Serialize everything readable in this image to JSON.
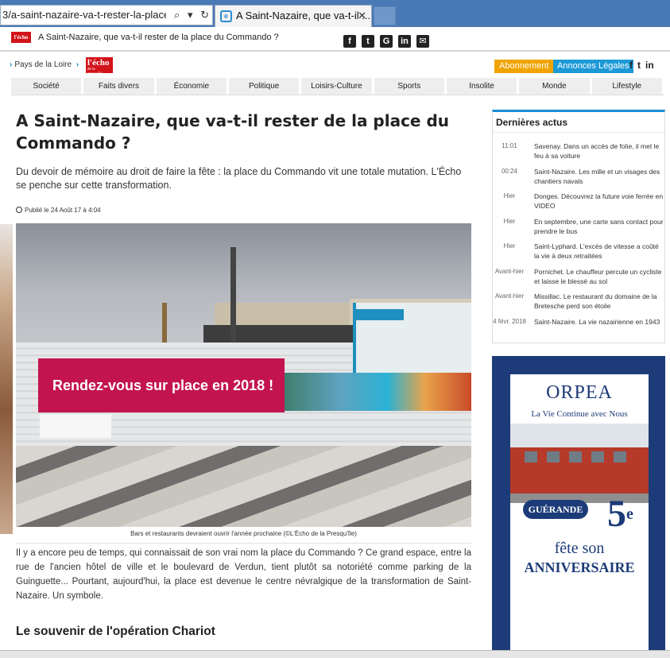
{
  "browser": {
    "url": "3/a-saint-nazaire-va-t-rester-la-place-co",
    "tab_title": "A Saint-Nazaire, que va-t-il ...",
    "tab_close": "✕",
    "search_glyph": "⌕",
    "reload_glyph": "↻",
    "favicon_letter": "e"
  },
  "topbar": {
    "logo": "l'écho",
    "title": "A Saint-Nazaire, que va-t-il rester de la place du Commando ?",
    "share_icons": [
      {
        "name": "facebook-icon",
        "glyph": "f"
      },
      {
        "name": "twitter-icon",
        "glyph": "t"
      },
      {
        "name": "google-plus-icon",
        "glyph": "G"
      },
      {
        "name": "linkedin-icon",
        "glyph": "in"
      },
      {
        "name": "email-icon",
        "glyph": "✉"
      }
    ]
  },
  "header": {
    "breadcrumb": "Pays de la Loire",
    "logo_top": "l'écho",
    "logo_bottom": "de la presqu'île",
    "abonnement": "Abonnement",
    "annonces": "Annonces Légales",
    "social": [
      "f",
      "t",
      "in"
    ]
  },
  "nav": [
    "Société",
    "Faits divers",
    "Économie",
    "Politique",
    "Loisirs-Culture",
    "Sports",
    "Insolite",
    "Monde",
    "Lifestyle"
  ],
  "article": {
    "title": "A Saint-Nazaire, que va-t-il rester de la place du Commando ?",
    "chapo": "Du devoir de mémoire au droit de faire la fête : la place du Commando vit une totale mutation. L'Écho se penche sur cette transformation.",
    "published": "Publié le 24 Août 17 à 4:04",
    "photo_banner_text": "Rendez-vous sur place en 2018 !",
    "caption": "Bars et restaurants devraient ouvrir l'année prochaine (©L'Écho de la Presqu'île)",
    "body": "Il y a encore peu de temps, qui connaissait de son vrai nom la place du Commando ? Ce grand espace, entre la rue de l'ancien hôtel de ville et le boulevard de Verdun, tient plutôt sa notoriété comme parking de la Guinguette... Pourtant, aujourd'hui, la place est devenue le centre névralgique de la transformation de Saint-Nazaire. Un symbole.",
    "subhead": "Le souvenir de l'opération Chariot"
  },
  "sidebar": {
    "actus_title": "Dernières actus",
    "actus": [
      {
        "time": "11:01",
        "text": "Savenay. Dans un accès de folie, il met le feu à sa voiture"
      },
      {
        "time": "00:24",
        "text": "Saint-Nazaire. Les mille et un visages des chantiers navals"
      },
      {
        "time": "Hier",
        "text": "Donges. Découvrez la future voie ferrée en VIDEO"
      },
      {
        "time": "Hier",
        "text": "En septembre, une carte sans contact pour prendre le bus"
      },
      {
        "time": "Hier",
        "text": "Saint-Lyphard. L'excès de vitesse a coûté la vie à deux retraitées"
      },
      {
        "time": "Avant-hier",
        "text": "Pornichet. Le chauffeur percute un cycliste et laisse le blessé au sol"
      },
      {
        "time": "Avant-hier",
        "text": "Missillac. Le restaurant du domaine de la Bretesche perd son étoile"
      },
      {
        "time": "4 févr. 2018",
        "text": "Saint-Nazaire. La vie nazairienne en 1943"
      }
    ],
    "ad": {
      "brand": "ORPEA",
      "tagline": "La Vie Continue avec Nous",
      "badge": "GUÉRANDE",
      "number": "5",
      "sup": "e",
      "line1": "fête son",
      "line2": "ANNIVERSAIRE"
    }
  },
  "colors": {
    "accent_blue": "#1a8fd6",
    "abonnement_orange": "#f0a400",
    "logo_red": "#d2141a",
    "orpea_navy": "#1c3b78"
  }
}
